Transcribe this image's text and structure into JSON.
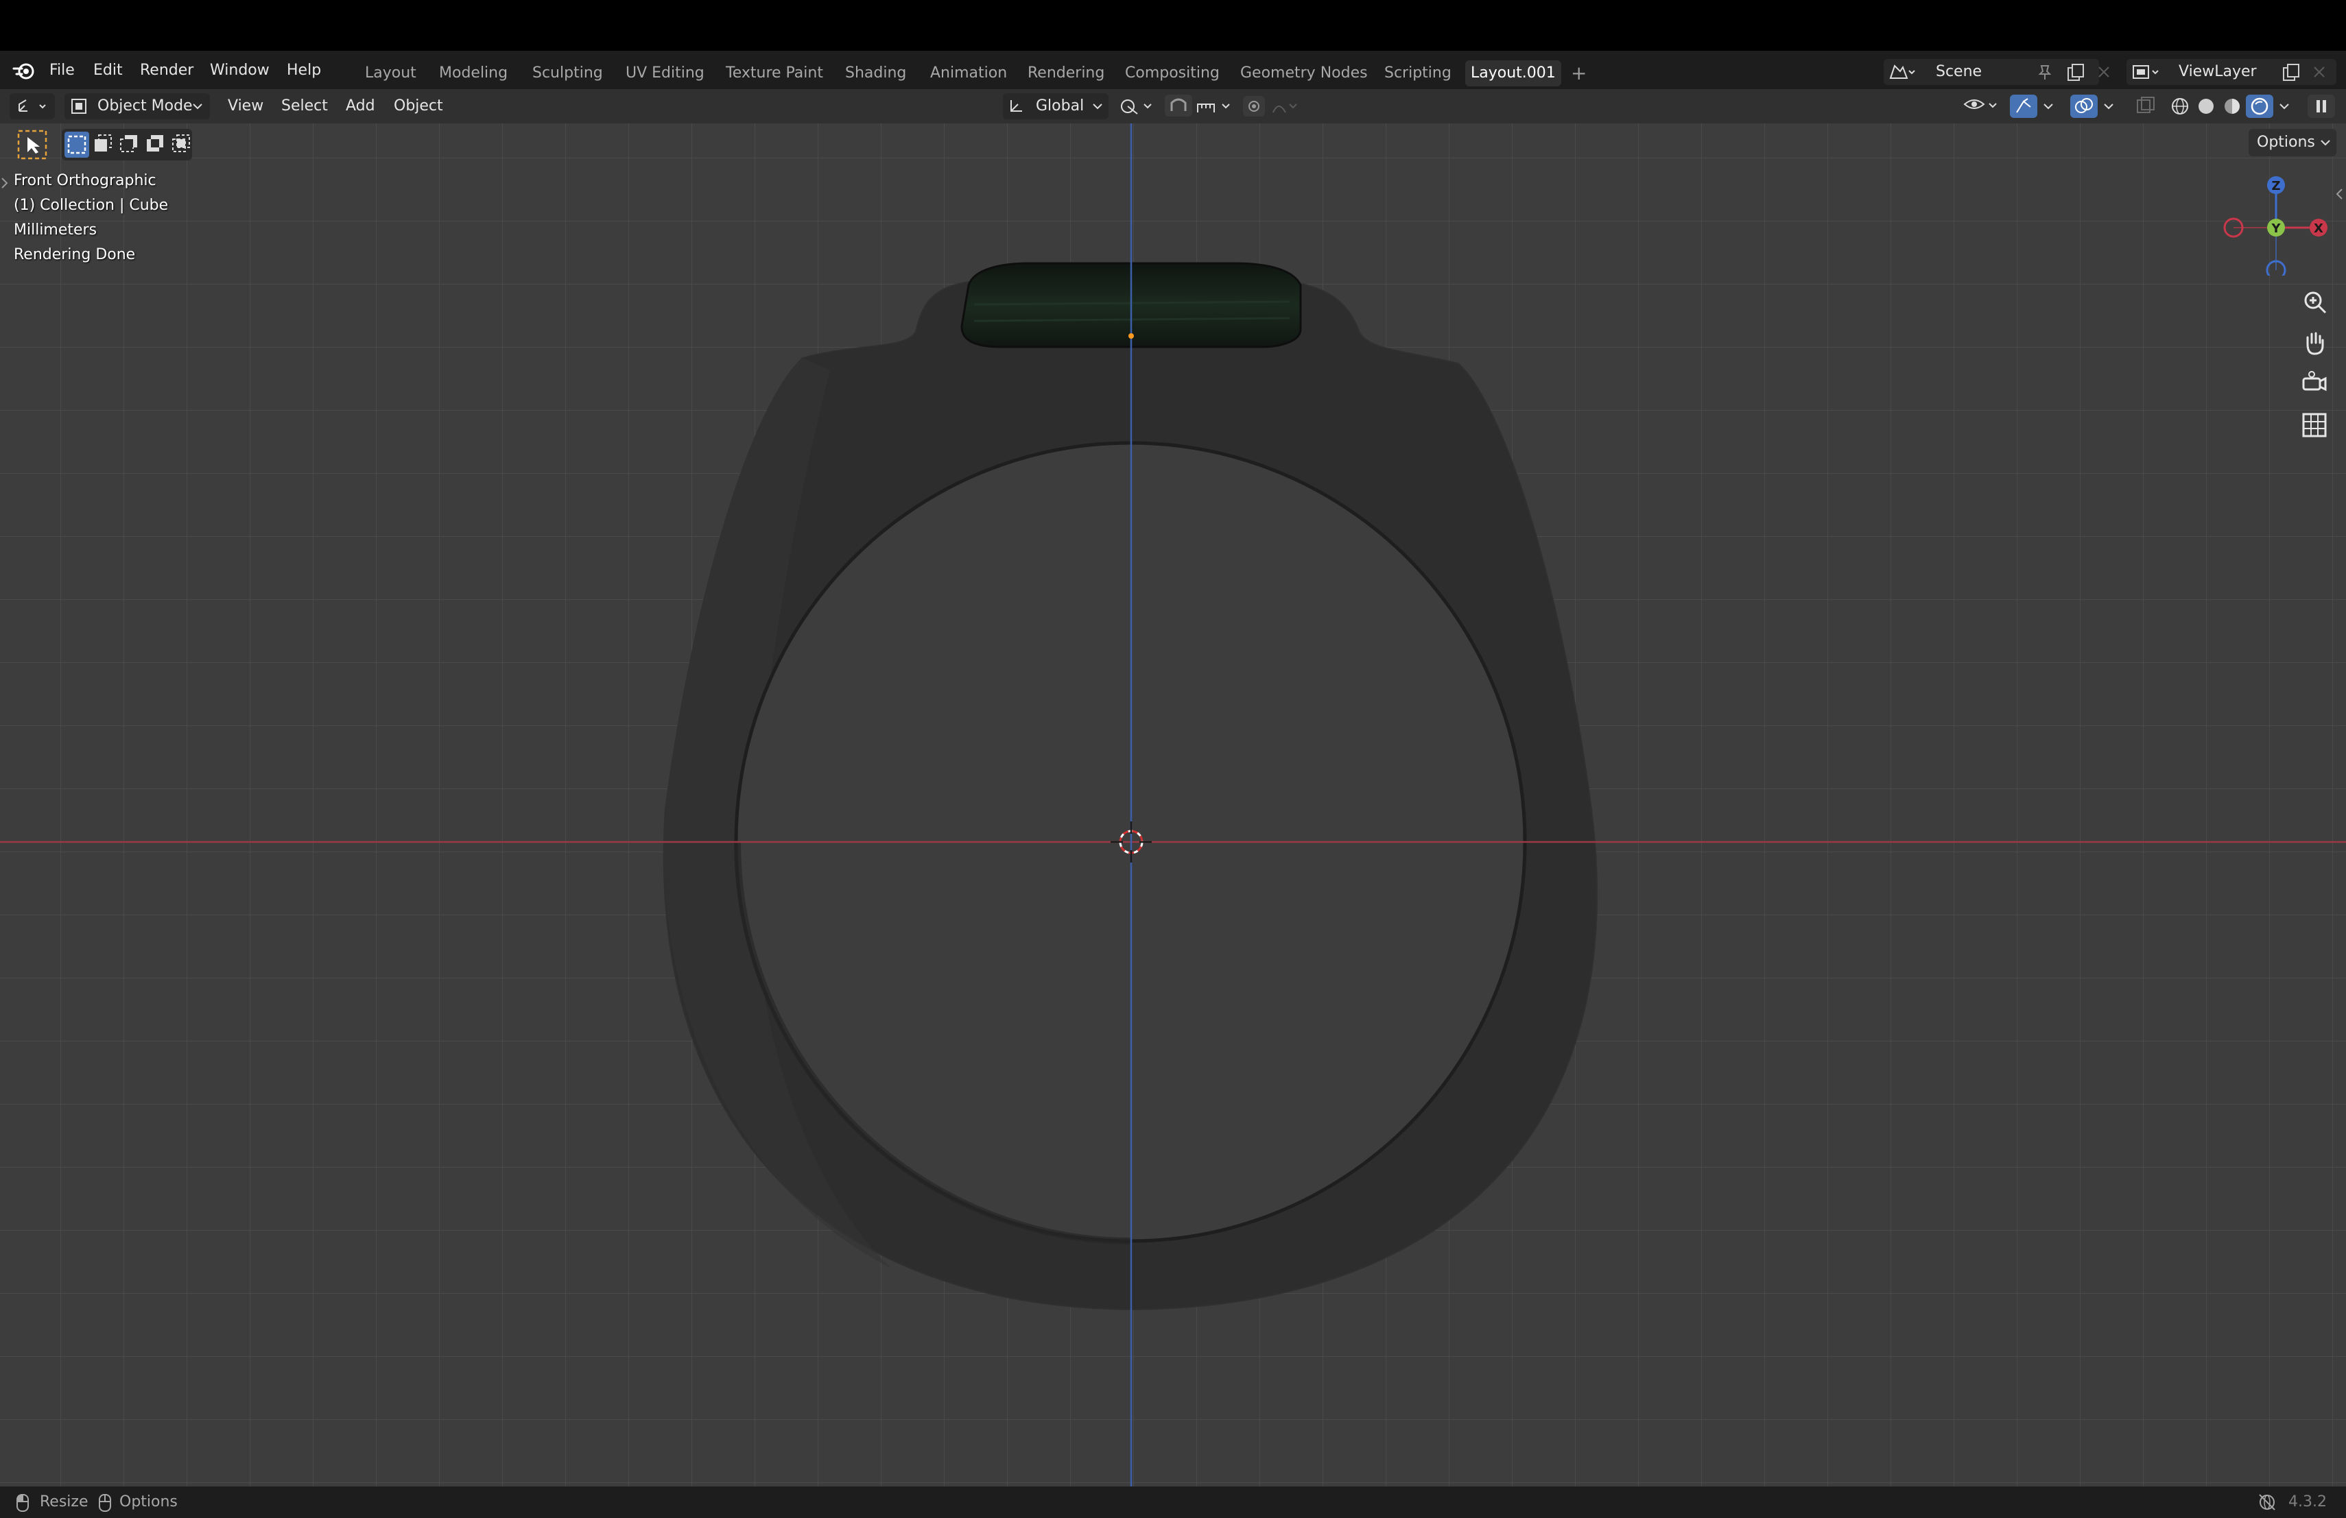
{
  "menubar": {
    "items": [
      "File",
      "Edit",
      "Render",
      "Window",
      "Help"
    ]
  },
  "workspaces": {
    "tabs": [
      "Layout",
      "Modeling",
      "Sculpting",
      "UV Editing",
      "Texture Paint",
      "Shading",
      "Animation",
      "Rendering",
      "Compositing",
      "Geometry Nodes",
      "Scripting",
      "Layout.001"
    ],
    "active": "Layout.001"
  },
  "scene": {
    "name": "Scene"
  },
  "view_layer": {
    "name": "ViewLayer"
  },
  "header": {
    "mode_label": "Object Mode",
    "menus": [
      "View",
      "Select",
      "Add",
      "Object"
    ],
    "orientation_label": "Global",
    "options_label": "Options"
  },
  "viewport": {
    "info_lines": [
      "Front Orthographic",
      "(1) Collection | Cube",
      "Millimeters",
      "Rendering Done"
    ],
    "gizmo": {
      "z": "Z",
      "y": "Y",
      "x": "X"
    }
  },
  "status": {
    "left_items": [
      "Resize",
      "Options"
    ],
    "version": "4.3.2"
  },
  "colors": {
    "x_axis": "#c8384a",
    "y_axis": "#8bc34a",
    "z_axis": "#3f6fce",
    "active_tool": "#e5a23a",
    "accent_blue": "#4772b3"
  }
}
